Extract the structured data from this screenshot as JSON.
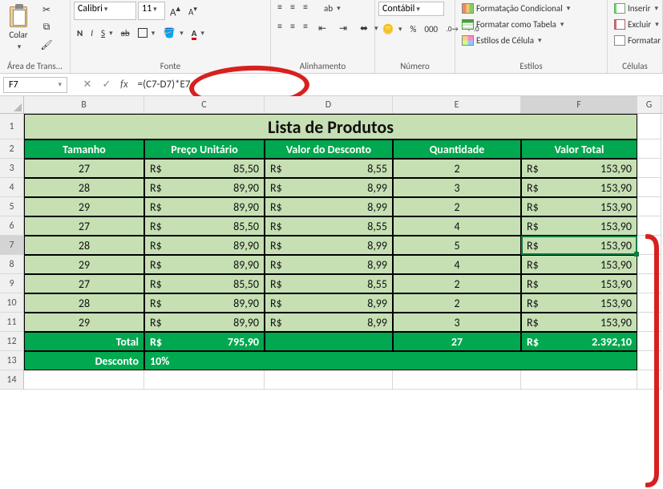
{
  "ribbon": {
    "clipboard": {
      "paste": "Colar",
      "group": "Área de Trans..."
    },
    "font": {
      "name": "Calibri",
      "size": "11",
      "bold": "N",
      "italic": "I",
      "underline": "S",
      "group": "Fonte"
    },
    "align": {
      "wrap": "ab",
      "group": "Alinhamento"
    },
    "number": {
      "format": "Contábil",
      "pct": "%",
      "thou": "000",
      "group": "Número"
    },
    "styles": {
      "cond": "Formatação Condicional",
      "table": "Formatar como Tabela",
      "cell": "Estilos de Célula",
      "group": "Estilos"
    },
    "cells": {
      "insert": "Inserir",
      "delete": "Excluir",
      "format": "Formatar",
      "group": "Células"
    }
  },
  "formula_bar": {
    "name_box": "F7",
    "cancel": "✕",
    "accept": "✓",
    "fx": "fx",
    "formula": "=(C7-D7)*E7"
  },
  "columns": [
    "B",
    "C",
    "D",
    "E",
    "F",
    "G"
  ],
  "active_col": "F",
  "active_row": "7",
  "sheet": {
    "title": "Lista de Produtos",
    "headers": [
      "Tamanho",
      "Preço Unitário",
      "Valor do Desconto",
      "Quantidade",
      "Valor Total"
    ],
    "rows": [
      {
        "r": "3",
        "size": "27",
        "price": "85,50",
        "disc": "8,55",
        "qty": "2",
        "total": "153,90"
      },
      {
        "r": "4",
        "size": "28",
        "price": "89,90",
        "disc": "8,99",
        "qty": "3",
        "total": "153,90"
      },
      {
        "r": "5",
        "size": "29",
        "price": "89,90",
        "disc": "8,99",
        "qty": "2",
        "total": "153,90"
      },
      {
        "r": "6",
        "size": "27",
        "price": "85,50",
        "disc": "8,55",
        "qty": "4",
        "total": "153,90"
      },
      {
        "r": "7",
        "size": "28",
        "price": "89,90",
        "disc": "8,99",
        "qty": "5",
        "total": "153,90"
      },
      {
        "r": "8",
        "size": "29",
        "price": "89,90",
        "disc": "8,99",
        "qty": "4",
        "total": "153,90"
      },
      {
        "r": "9",
        "size": "27",
        "price": "85,50",
        "disc": "8,55",
        "qty": "2",
        "total": "153,90"
      },
      {
        "r": "10",
        "size": "28",
        "price": "89,90",
        "disc": "8,99",
        "qty": "2",
        "total": "153,90"
      },
      {
        "r": "11",
        "size": "29",
        "price": "89,90",
        "disc": "8,99",
        "qty": "3",
        "total": "153,90"
      }
    ],
    "currency": "R$",
    "total_label": "Total",
    "total_price": "795,90",
    "total_qty": "27",
    "grand_total": "2.392,10",
    "discount_label": "Desconto",
    "discount_value": "10%"
  },
  "chart_data": {
    "type": "table",
    "title": "Lista de Produtos",
    "columns": [
      "Tamanho",
      "Preço Unitário (R$)",
      "Valor do Desconto (R$)",
      "Quantidade",
      "Valor Total (R$)"
    ],
    "rows": [
      [
        27,
        85.5,
        8.55,
        2,
        153.9
      ],
      [
        28,
        89.9,
        8.99,
        3,
        153.9
      ],
      [
        29,
        89.9,
        8.99,
        2,
        153.9
      ],
      [
        27,
        85.5,
        8.55,
        4,
        153.9
      ],
      [
        28,
        89.9,
        8.99,
        5,
        153.9
      ],
      [
        29,
        89.9,
        8.99,
        4,
        153.9
      ],
      [
        27,
        85.5,
        8.55,
        2,
        153.9
      ],
      [
        28,
        89.9,
        8.99,
        2,
        153.9
      ],
      [
        29,
        89.9,
        8.99,
        3,
        153.9
      ]
    ],
    "totals": {
      "Preço Unitário": 795.9,
      "Quantidade": 27,
      "Valor Total": 2392.1
    },
    "discount_pct": 10
  }
}
